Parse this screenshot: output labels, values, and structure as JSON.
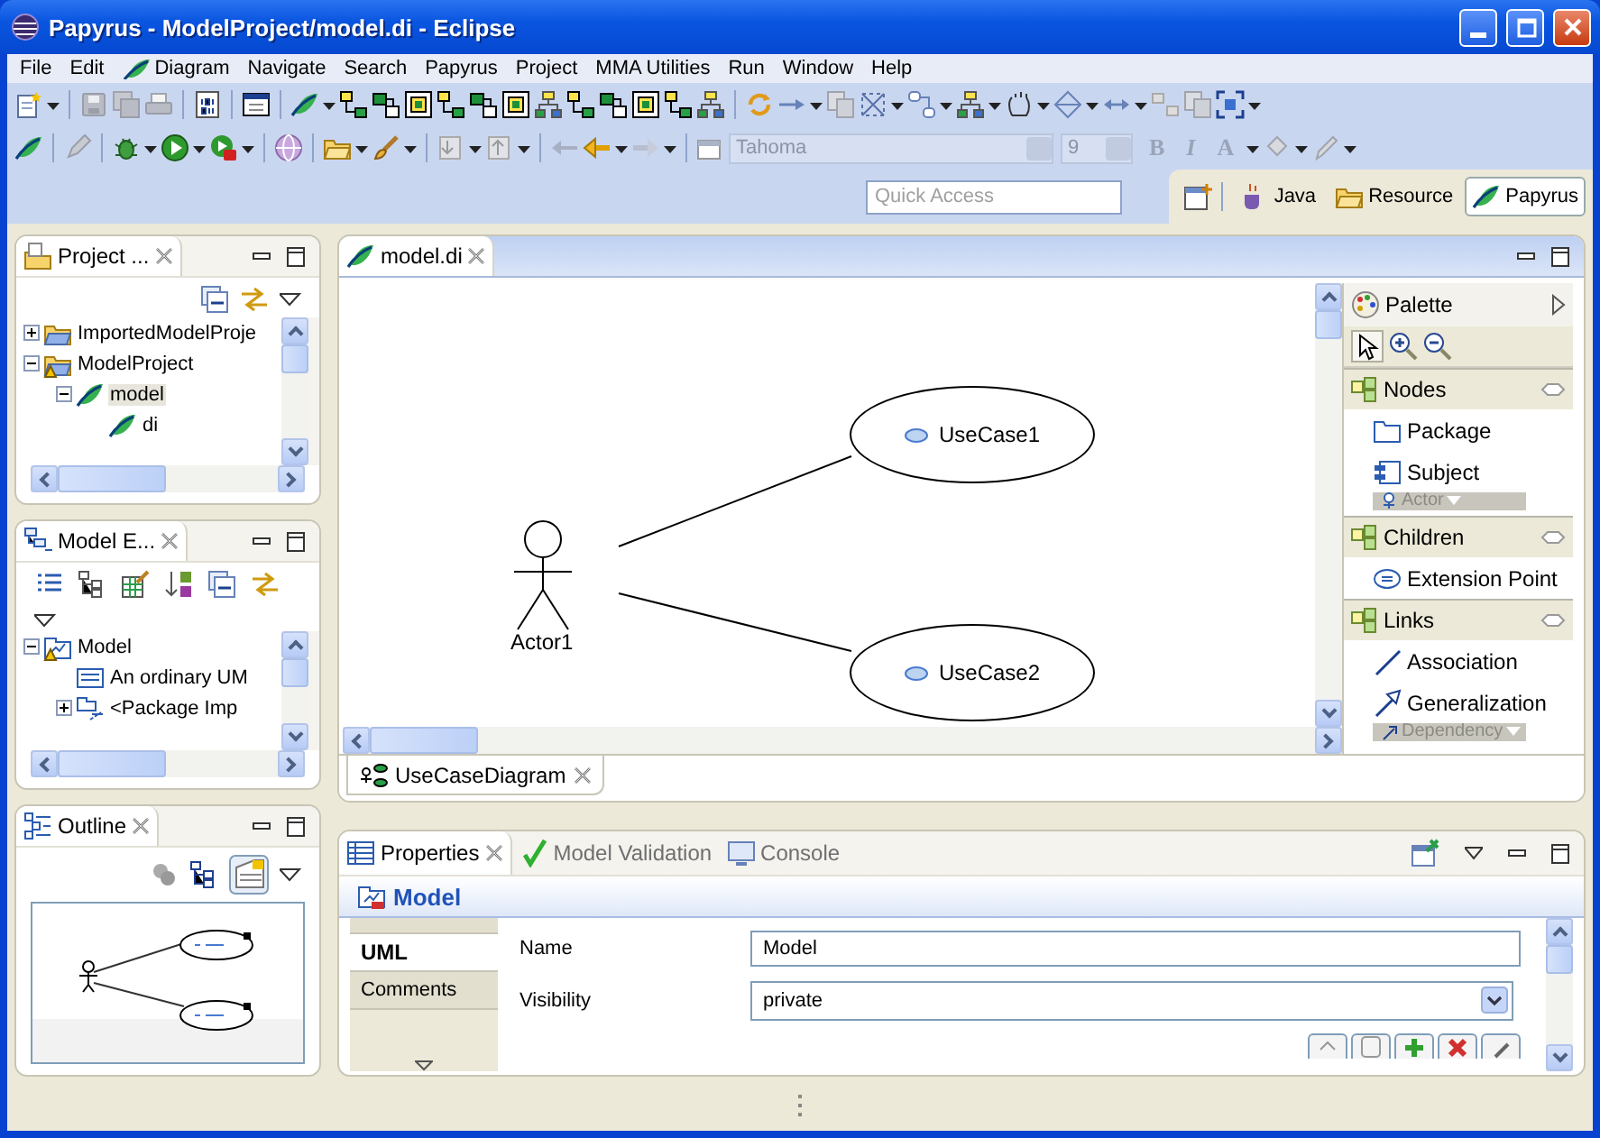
{
  "window": {
    "title": "Papyrus - ModelProject/model.di - Eclipse"
  },
  "menu": [
    {
      "label": "File",
      "has_icon": false
    },
    {
      "label": "Edit",
      "has_icon": false
    },
    {
      "label": "Diagram",
      "has_icon": true
    },
    {
      "label": "Navigate",
      "has_icon": false
    },
    {
      "label": "Search",
      "has_icon": false
    },
    {
      "label": "Papyrus",
      "has_icon": false
    },
    {
      "label": "Project",
      "has_icon": false
    },
    {
      "label": "MMA Utilities",
      "has_icon": false
    },
    {
      "label": "Run",
      "has_icon": false
    },
    {
      "label": "Window",
      "has_icon": false
    },
    {
      "label": "Help",
      "has_icon": false
    }
  ],
  "format_bar": {
    "font": "Tahoma",
    "size": "9",
    "disabled": true,
    "buttons": [
      {
        "label": "B",
        "kind": "bold"
      },
      {
        "label": "I",
        "kind": "italic"
      },
      {
        "label": "A",
        "kind": "color"
      }
    ]
  },
  "quick_access": {
    "placeholder": "Quick Access"
  },
  "perspectives": [
    {
      "label": "Java",
      "kind": "java",
      "selected": false
    },
    {
      "label": "Resource",
      "kind": "resource",
      "selected": false
    },
    {
      "label": "Papyrus",
      "kind": "papyrus",
      "selected": true
    }
  ],
  "project_explorer": {
    "title": "Project ...",
    "tree": [
      {
        "label": "ImportedModelProje",
        "kind": "project",
        "expanded": false,
        "warning": false,
        "selected": false
      },
      {
        "label": "ModelProject",
        "kind": "project",
        "expanded": true,
        "warning": true,
        "selected": false,
        "children": [
          {
            "label": "model",
            "kind": "model",
            "expanded": true,
            "warning": false,
            "selected": true,
            "children": [
              {
                "label": "di",
                "kind": "model",
                "warning": false,
                "selected": false
              }
            ]
          }
        ]
      }
    ]
  },
  "model_explorer": {
    "title": "Model E...",
    "tree": [
      {
        "label": "Model",
        "kind": "uml_model",
        "expanded": true,
        "warning": true,
        "selected": false,
        "children": [
          {
            "label": "An ordinary UM",
            "kind": "comment",
            "warning": false,
            "selected": false
          },
          {
            "label": "<Package Imp",
            "kind": "package_import",
            "expanded": false,
            "warning": false,
            "selected": false
          }
        ]
      }
    ]
  },
  "outline": {
    "title": "Outline"
  },
  "editor": {
    "tab": "model.di",
    "diagram_tab": "UseCaseDiagram",
    "actor": {
      "label": "Actor1"
    },
    "use_cases": [
      {
        "label": "UseCase1"
      },
      {
        "label": "UseCase2"
      }
    ]
  },
  "palette": {
    "title": "Palette",
    "groups": [
      {
        "label": "Nodes",
        "items": [
          {
            "label": "Package",
            "kind": "package"
          },
          {
            "label": "Subject",
            "kind": "subject"
          }
        ],
        "more": {
          "label": "Actor",
          "kind": "actor"
        }
      },
      {
        "label": "Children",
        "items": [
          {
            "label": "Extension Point",
            "kind": "extension_point"
          }
        ]
      },
      {
        "label": "Links",
        "items": [
          {
            "label": "Association",
            "kind": "association"
          },
          {
            "label": "Generalization",
            "kind": "generalization"
          }
        ],
        "more": {
          "label": "Dependency",
          "kind": "dependency"
        }
      }
    ]
  },
  "properties": {
    "tabs": [
      {
        "label": "Properties",
        "kind": "properties",
        "selected": true
      },
      {
        "label": "Model Validation",
        "kind": "validation",
        "selected": false
      },
      {
        "label": "Console",
        "kind": "console",
        "selected": false
      }
    ],
    "title": "Model",
    "sections": [
      {
        "label": "UML",
        "selected": true
      },
      {
        "label": "Comments",
        "selected": false
      }
    ],
    "fields": [
      {
        "label": "Name",
        "kind": "text",
        "value": "Model"
      },
      {
        "label": "Visibility",
        "kind": "combo",
        "value": "private"
      }
    ]
  }
}
